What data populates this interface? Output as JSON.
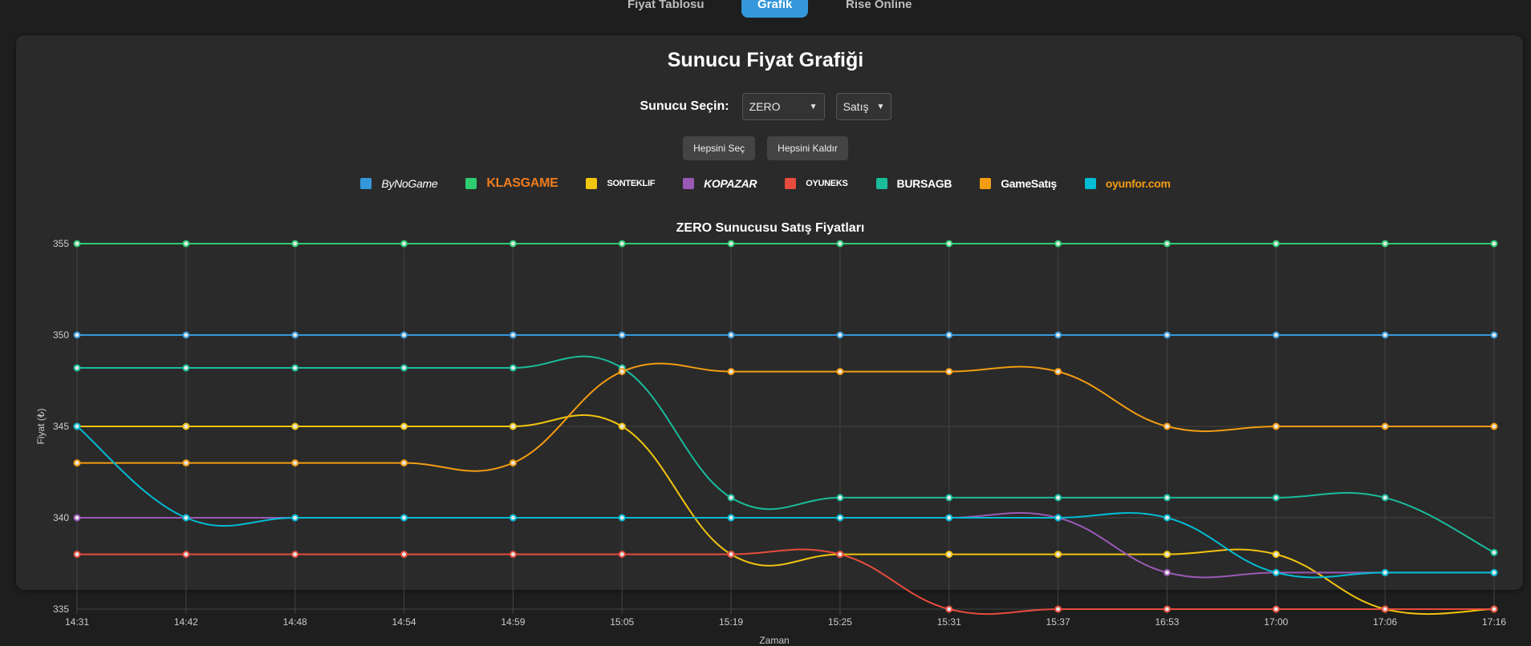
{
  "tabs": [
    {
      "label": "Fiyat Tablosu",
      "active": false
    },
    {
      "label": "Grafik",
      "active": true
    },
    {
      "label": "Rise Online",
      "active": false
    }
  ],
  "page_title": "Sunucu Fiyat Grafiği",
  "controls": {
    "server_label": "Sunucu Seçin:",
    "server_value": "ZERO",
    "type_value": "Satış",
    "select_all_label": "Hepsini Seç",
    "clear_all_label": "Hepsini Kaldır"
  },
  "legend": [
    {
      "name": "ByNoGame",
      "logo_text": "ByNoGame",
      "color": "#3498db"
    },
    {
      "name": "KlasGame",
      "logo_text": "KLASGAME",
      "color": "#2ecc71"
    },
    {
      "name": "SonTeklif",
      "logo_text": "SONTEKLIF",
      "color": "#f1c40f"
    },
    {
      "name": "KoPazar",
      "logo_text": "KOPAZAR",
      "color": "#9b59b6"
    },
    {
      "name": "Oyuneks",
      "logo_text": "OYUNEKS",
      "color": "#e74c3c"
    },
    {
      "name": "BursaGB",
      "logo_text": "BURSAGB",
      "color": "#1abc9c"
    },
    {
      "name": "GameSatis",
      "logo_text": "GameSatış",
      "color": "#f39c12"
    },
    {
      "name": "Oyunfor",
      "logo_text": "oyunfor.com",
      "color": "#00bcd4"
    }
  ],
  "chart_data": {
    "type": "line",
    "title": "ZERO Sunucusu Satış Fiyatları",
    "xlabel": "Zaman",
    "ylabel": "Fiyat (₺)",
    "ylim": [
      335,
      355
    ],
    "yticks": [
      335,
      340,
      345,
      350,
      355
    ],
    "grid": true,
    "categories": [
      "14:31",
      "14:42",
      "14:48",
      "14:54",
      "14:59",
      "15:05",
      "15:19",
      "15:25",
      "15:31",
      "15:37",
      "16:53",
      "17:00",
      "17:06",
      "17:16"
    ],
    "series": [
      {
        "name": "ByNoGame",
        "color": "#3498db",
        "values": [
          350,
          350,
          350,
          350,
          350,
          350,
          350,
          350,
          350,
          350,
          350,
          350,
          350,
          350
        ]
      },
      {
        "name": "KlasGame",
        "color": "#2ecc71",
        "values": [
          355,
          355,
          355,
          355,
          355,
          355,
          355,
          355,
          355,
          355,
          355,
          355,
          355,
          355
        ]
      },
      {
        "name": "SonTeklif",
        "color": "#f1c40f",
        "values": [
          345,
          345,
          345,
          345,
          345,
          345,
          338,
          338,
          338,
          338,
          338,
          338,
          335,
          335
        ]
      },
      {
        "name": "KoPazar",
        "color": "#9b59b6",
        "values": [
          340,
          340,
          340,
          340,
          340,
          340,
          340,
          340,
          340,
          340,
          337,
          337,
          337,
          337
        ]
      },
      {
        "name": "Oyuneks",
        "color": "#e74c3c",
        "values": [
          338,
          338,
          338,
          338,
          338,
          338,
          338,
          338,
          335,
          335,
          335,
          335,
          335,
          335
        ]
      },
      {
        "name": "BursaGB",
        "color": "#1abc9c",
        "values": [
          348.2,
          348.2,
          348.2,
          348.2,
          348.2,
          348.2,
          341.1,
          341.1,
          341.1,
          341.1,
          341.1,
          341.1,
          341.1,
          338.1
        ]
      },
      {
        "name": "GameSatis",
        "color": "#f39c12",
        "values": [
          343,
          343,
          343,
          343,
          343,
          348,
          348,
          348,
          348,
          348,
          345,
          345,
          345,
          345
        ]
      },
      {
        "name": "Oyunfor",
        "color": "#00bcd4",
        "values": [
          345,
          340,
          340,
          340,
          340,
          340,
          340,
          340,
          340,
          340,
          340,
          337,
          337,
          337
        ]
      }
    ]
  }
}
